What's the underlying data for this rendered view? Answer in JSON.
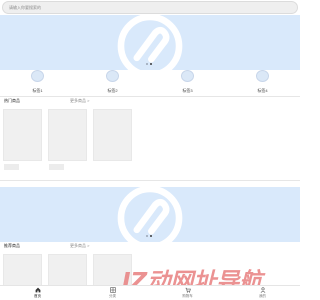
{
  "search": {
    "placeholder": "请输入你要搜索的"
  },
  "banners": [
    {
      "active_dot": 1,
      "dot_count": 2
    },
    {
      "active_dot": 1,
      "dot_count": 2
    }
  ],
  "quick_links": [
    {
      "label": "标签1"
    },
    {
      "label": "标签2"
    },
    {
      "label": "标签3"
    },
    {
      "label": "标签4"
    }
  ],
  "section_hot": {
    "title": "热门商品",
    "more": "更多商品 >"
  },
  "section_recommend": {
    "title": "推荐商品",
    "more": "更多商品 >"
  },
  "watermark": "IZ动网址导航",
  "tabbar": {
    "items": [
      {
        "label": "首页",
        "icon": "home-icon",
        "active": true
      },
      {
        "label": "分类",
        "icon": "category-icon",
        "active": false
      },
      {
        "label": "购物车",
        "icon": "cart-icon",
        "active": false
      },
      {
        "label": "我的",
        "icon": "user-icon",
        "active": false
      }
    ]
  },
  "colors": {
    "banner": "#d9e9fb",
    "accent": "#3a3a3a",
    "watermark": "#e98787"
  }
}
